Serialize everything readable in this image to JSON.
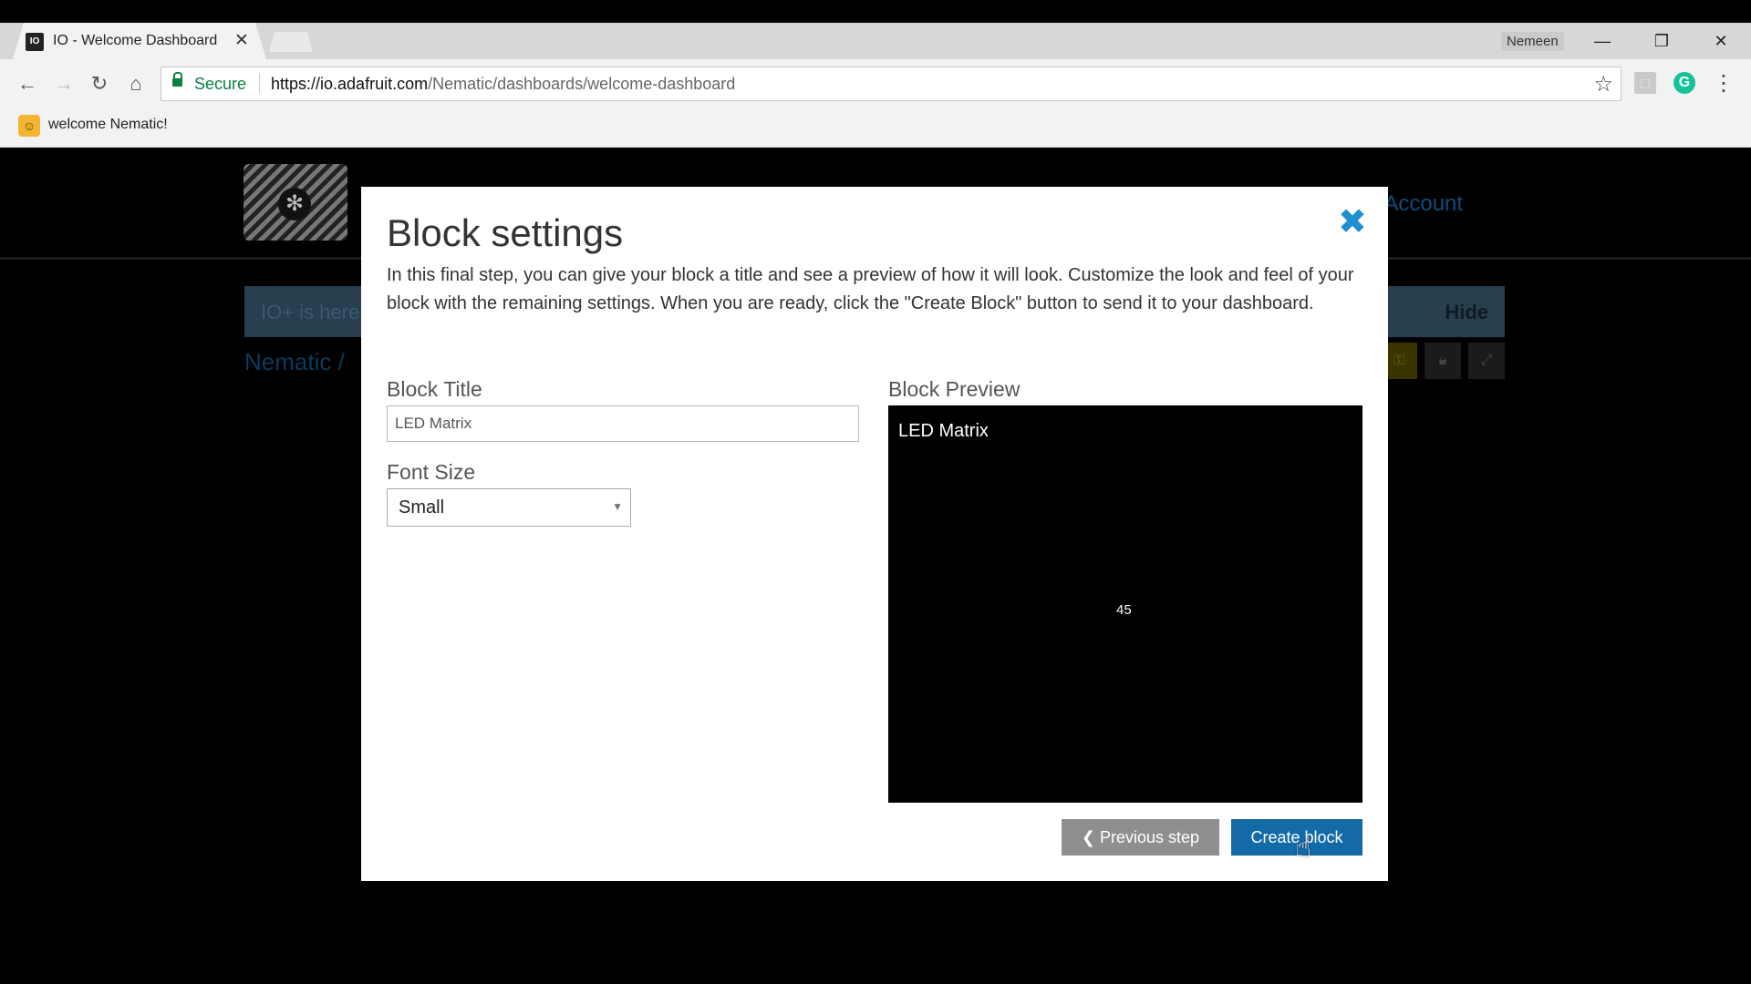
{
  "browser": {
    "tab_title": "IO - Welcome Dashboard",
    "tab_close": "✕",
    "user_label": "Nemeen",
    "secure_label": "Secure",
    "url_host": "https://io.adafruit.com",
    "url_path": "/Nematic/dashboards/welcome-dashboard",
    "bookmark_label": "welcome Nematic!",
    "window_controls": {
      "minimize": "—",
      "restore": "❐",
      "close": "✕"
    }
  },
  "page": {
    "account_link": "y Account",
    "banner_text": "IO+ is here",
    "banner_hide": "Hide",
    "breadcrumb": "Nematic /"
  },
  "modal": {
    "title": "Block settings",
    "close_icon": "✖",
    "description": "In this final step, you can give your block a title and see a preview of how it will look. Customize the look and feel of your block with the remaining settings. When you are ready, click the \"Create Block\" button to send it to your dashboard.",
    "block_title_label": "Block Title",
    "block_title_value": "LED Matrix",
    "font_size_label": "Font Size",
    "font_size_value": "Small",
    "preview_label": "Block Preview",
    "preview_title": "LED Matrix",
    "preview_value": "45",
    "prev_button": "❮ Previous step",
    "create_button": "Create block"
  }
}
